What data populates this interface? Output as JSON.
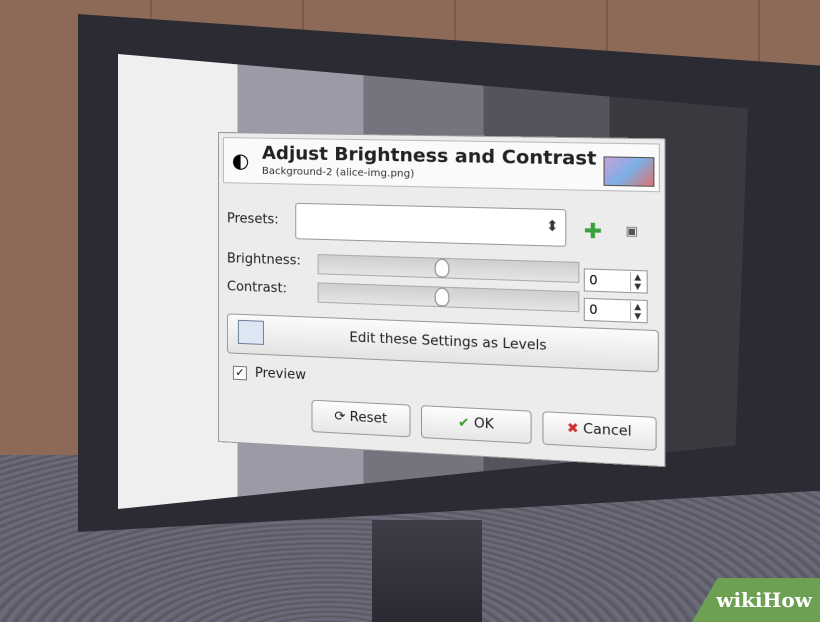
{
  "dialog": {
    "title": "Adjust Brightness and Contrast",
    "subtitle": "Background-2 (alice-img.png)",
    "presets_label": "Presets:",
    "presets_value": "",
    "brightness_label": "Brightness:",
    "brightness_value": "0",
    "contrast_label": "Contrast:",
    "contrast_value": "0",
    "levels_button": "Edit these Settings as Levels",
    "preview_label": "Preview",
    "preview_checked": "✓",
    "reset_button": "Reset",
    "ok_button": "OK",
    "cancel_button": "Cancel"
  },
  "watermark": "wikiHow",
  "icons": {
    "dialog": "brightness-contrast-icon",
    "add_preset": "plus-icon",
    "preset_menu": "menu-icon",
    "levels": "levels-icon",
    "reset": "reset-icon",
    "ok": "checkmark-icon",
    "cancel": "x-icon"
  },
  "colors": {
    "ok_check": "#3a9a2a",
    "cancel_x": "#d03030",
    "add_plus": "#3aa03a"
  }
}
